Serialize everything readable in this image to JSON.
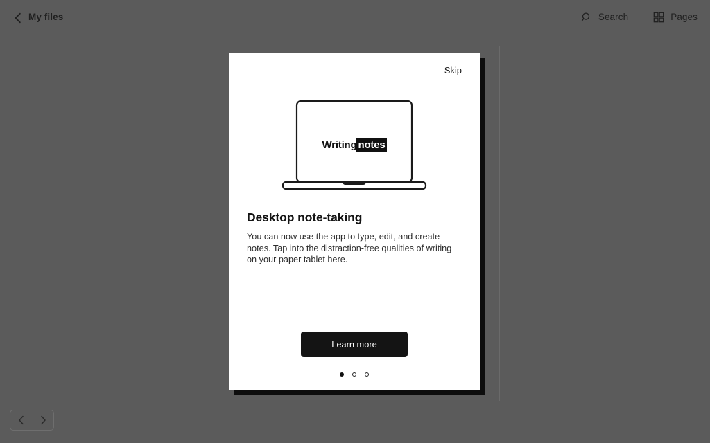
{
  "topbar": {
    "back_icon": "chevron-left-icon",
    "title": "My files",
    "search": {
      "icon": "search-icon",
      "label": "Search"
    },
    "pages": {
      "icon": "pages-grid-icon",
      "label": "Pages"
    }
  },
  "card": {
    "skip_label": "Skip",
    "illustration": {
      "name": "laptop-illustration",
      "screen_text_plain": "Writing",
      "screen_text_highlight": "notes"
    },
    "title": "Desktop note-taking",
    "body": "You can now use the app to type, edit, and create notes. Tap into the distraction-free qualities of writing on your paper tablet here.",
    "cta_label": "Learn more",
    "dots": [
      {
        "state": "active"
      },
      {
        "state": "inactive"
      },
      {
        "state": "inactive"
      }
    ]
  },
  "pager": {
    "prev_icon": "chevron-left-icon",
    "next_icon": "chevron-right-icon"
  },
  "colors": {
    "background": "#5b5b5b",
    "card_background": "#ffffff",
    "card_shadow": "#0d0d0d",
    "accent_dark": "#141414",
    "frame_border": "#6a6a6a",
    "text_primary": "#141414",
    "text_body": "#2d2d2d"
  }
}
